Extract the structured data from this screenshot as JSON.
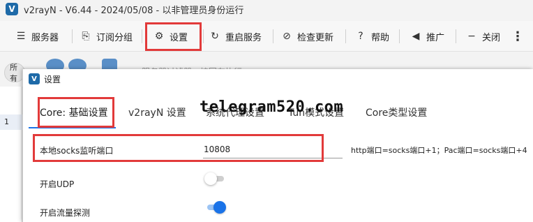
{
  "window": {
    "logo_letter": "V",
    "title": "v2rayN - V6.44 - 2024/05/08 - 以非管理员身份运行"
  },
  "toolbar": {
    "items": [
      {
        "label": "服务器",
        "icon": "server-icon",
        "glyph": "☰"
      },
      {
        "label": "订阅分组",
        "icon": "subscription-icon",
        "glyph": "⎘"
      },
      {
        "label": "设置",
        "icon": "gear-icon",
        "glyph": "⚙"
      },
      {
        "label": "重启服务",
        "icon": "restart-icon",
        "glyph": "↻"
      },
      {
        "label": "检查更新",
        "icon": "update-icon",
        "glyph": "⊘"
      },
      {
        "label": "帮助",
        "icon": "help-icon",
        "glyph": "?"
      },
      {
        "label": "推广",
        "icon": "speaker-icon",
        "glyph": "◀"
      },
      {
        "label": "关闭",
        "icon": "minus-icon",
        "glyph": "−"
      }
    ],
    "more_glyph": "⋮"
  },
  "background": {
    "pill_label": "所有",
    "filter_text": "服务器过滤器，按回车执行",
    "row_number": "1"
  },
  "dialog": {
    "logo_letter": "V",
    "title": "设置",
    "tabs": [
      "Core: 基础设置",
      "v2rayN 设置",
      "系统代理设置",
      "Tun模式设置",
      "Core类型设置"
    ],
    "active_tab": 0,
    "watermark": "telegram520.com",
    "fields": {
      "socks_port_label": "本地socks监听端口",
      "socks_port_value": "10808",
      "socks_port_hint": "http端口=socks端口+1；Pac端口=socks端口+4",
      "udp_label": "开启UDP",
      "udp_enabled": false,
      "sniffing_label": "开启流量探测",
      "sniffing_enabled": true
    }
  },
  "colors": {
    "highlight": "#e23a3a",
    "accent": "#1a73e8",
    "logo": "#1e6aa8"
  }
}
